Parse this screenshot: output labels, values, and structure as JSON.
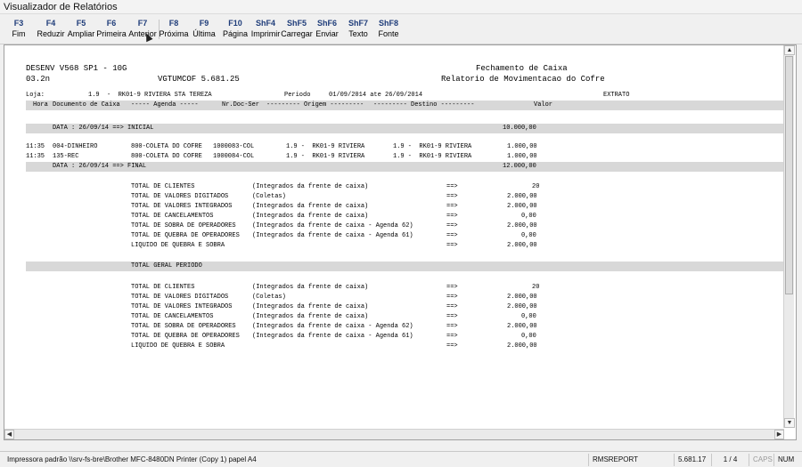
{
  "window": {
    "title": "Visualizador de Relatórios"
  },
  "toolbar": {
    "buttons": [
      {
        "key": "F3",
        "label": "Fim"
      },
      {
        "key": "F4",
        "label": "Reduzir"
      },
      {
        "key": "F5",
        "label": "Ampliar"
      },
      {
        "key": "F6",
        "label": "Primeira"
      },
      {
        "key": "F7",
        "label": "Anterior"
      },
      {
        "key": "F8",
        "label": "Próxima"
      },
      {
        "key": "F9",
        "label": "Última"
      },
      {
        "key": "F10",
        "label": "Página"
      },
      {
        "key": "ShF4",
        "label": "Imprimir"
      },
      {
        "key": "ShF5",
        "label": "Carregar"
      },
      {
        "key": "ShF6",
        "label": "Enviar"
      },
      {
        "key": "ShF7",
        "label": "Texto"
      },
      {
        "key": "ShF8",
        "label": "Fonte"
      }
    ]
  },
  "report": {
    "header": {
      "system": "DESENV V568 SP1 - 10G",
      "title": "Fechamento de Caixa",
      "version_code": "03.2n",
      "program": "VGTUMCOF 5.681.25",
      "subtitle": "Relatorio de Movimentacao do Cofre"
    },
    "filter": {
      "loja_label": "Loja:",
      "loja_value": "1.9  -  RK01-9 RIVIERA STA TEREZA",
      "periodo_label": "Periodo",
      "periodo_value": "01/09/2014 ate 26/09/2014",
      "tipo": "EXTRATO"
    },
    "columns": {
      "hora": "Hora",
      "documento": "Documento de Caixa",
      "agenda": "----- Agenda -----",
      "nrdoc": "Nr.Doc-Ser",
      "origem": "--------- Origem ---------",
      "destino": "--------- Destino ---------",
      "valor": "Valor"
    },
    "inicial": {
      "label": "DATA : 26/09/14 ==> INICIAL",
      "valor": "10.000,00"
    },
    "rows": [
      {
        "hora": "11:35",
        "documento": "004-DINHEIRO",
        "agenda": "800-COLETA DO COFRE",
        "nrdoc": "1000083-COL",
        "origem": "1.9 -  RK01-9 RIVIERA",
        "destino": "1.9 -  RK01-9 RIVIERA",
        "valor": "1.000,00"
      },
      {
        "hora": "11:35",
        "documento": "135-REC",
        "agenda": "800-COLETA DO COFRE",
        "nrdoc": "1000084-COL",
        "origem": "1.9 -  RK01-9 RIVIERA",
        "destino": "1.9 -  RK01-9 RIVIERA",
        "valor": "1.000,00"
      }
    ],
    "final": {
      "label": "DATA : 26/09/14 ==> FINAL",
      "valor": "12.000,00"
    },
    "totals_day": [
      {
        "label": "TOTAL DE CLIENTES",
        "desc": "(Integrados da frente de caixa)",
        "arrow": "==>",
        "valor": "20"
      },
      {
        "label": "TOTAL DE VALORES DIGITADOS",
        "desc": "(Coletas)",
        "arrow": "==>",
        "valor": "2.000,00"
      },
      {
        "label": "TOTAL DE VALORES INTEGRADOS",
        "desc": "(Integrados da frente de caixa)",
        "arrow": "==>",
        "valor": "2.000,00"
      },
      {
        "label": "TOTAL DE CANCELAMENTOS",
        "desc": "(Integrados da frente de caixa)",
        "arrow": "==>",
        "valor": "0,00"
      },
      {
        "label": "TOTAL DE SOBRA DE OPERADORES",
        "desc": "(Integrados da frente de caixa - Agenda 62)",
        "arrow": "==>",
        "valor": "2.000,00"
      },
      {
        "label": "TOTAL DE QUEBRA DE OPERADORES",
        "desc": "(Integrados da frente de caixa - Agenda 61)",
        "arrow": "==>",
        "valor": "0,00"
      },
      {
        "label": "LIQUIDO DE QUEBRA E SOBRA",
        "desc": "",
        "arrow": "==>",
        "valor": "2.000,00"
      }
    ],
    "geral_label": "TOTAL GERAL PERIODO",
    "totals_geral": [
      {
        "label": "TOTAL DE CLIENTES",
        "desc": "(Integrados da frente de caixa)",
        "arrow": "==>",
        "valor": "20"
      },
      {
        "label": "TOTAL DE VALORES DIGITADOS",
        "desc": "(Coletas)",
        "arrow": "==>",
        "valor": "2.000,00"
      },
      {
        "label": "TOTAL DE VALORES INTEGRADOS",
        "desc": "(Integrados da frente de caixa)",
        "arrow": "==>",
        "valor": "2.000,00"
      },
      {
        "label": "TOTAL DE CANCELAMENTOS",
        "desc": "(Integrados da frente de caixa)",
        "arrow": "==>",
        "valor": "0,00"
      },
      {
        "label": "TOTAL DE SOBRA DE OPERADORES",
        "desc": "(Integrados da frente de caixa - Agenda 62)",
        "arrow": "==>",
        "valor": "2.000,00"
      },
      {
        "label": "TOTAL DE QUEBRA DE OPERADORES",
        "desc": "(Integrados da frente de caixa - Agenda 61)",
        "arrow": "==>",
        "valor": "0,00"
      },
      {
        "label": "LIQUIDO DE QUEBRA E SOBRA",
        "desc": "",
        "arrow": "==>",
        "valor": "2.000,00"
      }
    ]
  },
  "status": {
    "printer": "Impressora padrão \\\\srv-fs-bre\\Brother MFC-8480DN Printer (Copy 1) papel A4",
    "report_name": "RMSREPORT",
    "version": "5.681.17",
    "page": "1 / 4",
    "caps": "CAPS",
    "num": "NUM"
  }
}
